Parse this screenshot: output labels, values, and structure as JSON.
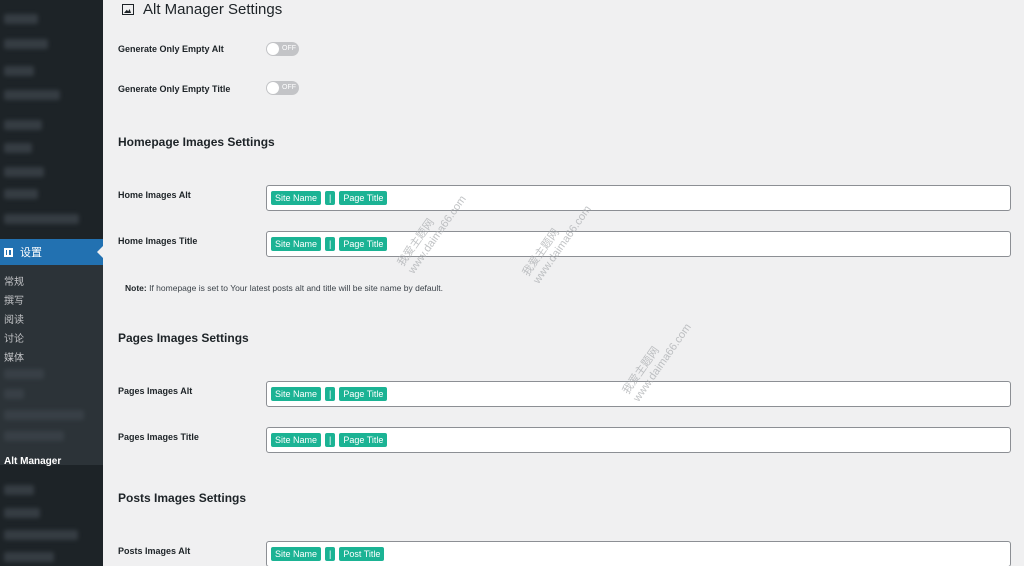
{
  "sidebar": {
    "settings_label": "设置",
    "submenu": [
      "常规",
      "撰写",
      "阅读",
      "讨论",
      "媒体"
    ],
    "current_item": "Alt Manager"
  },
  "page": {
    "title": "Alt Manager Settings"
  },
  "toggles": [
    {
      "label": "Generate Only Empty Alt",
      "state": "OFF"
    },
    {
      "label": "Generate Only Empty Title",
      "state": "OFF"
    }
  ],
  "sections": {
    "home": {
      "title": "Homepage Images Settings",
      "alt_label": "Home Images Alt",
      "alt_tags": [
        "Site Name",
        "|",
        "Page Title"
      ],
      "title_label": "Home Images Title",
      "title_tags": [
        "Site Name",
        "|",
        "Page Title"
      ],
      "note_bold": "Note:",
      "note_text": " If homepage is set to Your latest posts alt and title will be site name by default."
    },
    "pages": {
      "title": "Pages Images Settings",
      "alt_label": "Pages Images Alt",
      "alt_tags": [
        "Site Name",
        "|",
        "Page Title"
      ],
      "title_label": "Pages Images Title",
      "title_tags": [
        "Site Name",
        "|",
        "Page Title"
      ]
    },
    "posts": {
      "title": "Posts Images Settings",
      "alt_label": "Posts Images Alt",
      "alt_tags": [
        "Site Name",
        "|",
        "Post Title"
      ]
    }
  },
  "watermark": {
    "line1": "我爱主题网",
    "line2": "www.daima66.com"
  },
  "colors": {
    "sidebar": "#1d2327",
    "active_menu": "#2271b1",
    "tag": "#1bb394",
    "background": "#f0f0f1"
  }
}
